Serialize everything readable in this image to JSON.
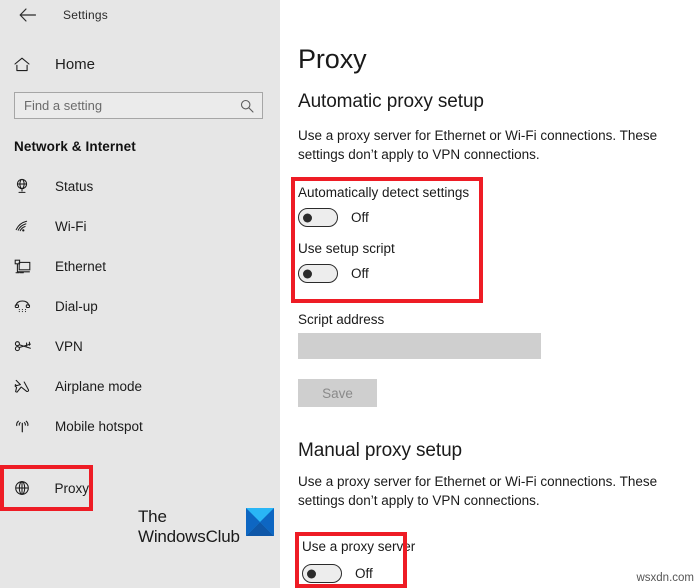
{
  "window": {
    "back_icon": "back-arrow-icon",
    "title": "Settings"
  },
  "sidebar": {
    "home": {
      "label": "Home",
      "icon": "home-icon"
    },
    "search": {
      "placeholder": "Find a setting",
      "value": "",
      "icon": "search-icon"
    },
    "section_title": "Network & Internet",
    "items": [
      {
        "label": "Status",
        "icon": "status-globe-icon",
        "selected": false
      },
      {
        "label": "Wi-Fi",
        "icon": "wifi-icon",
        "selected": false
      },
      {
        "label": "Ethernet",
        "icon": "ethernet-icon",
        "selected": false
      },
      {
        "label": "Dial-up",
        "icon": "dialup-phone-icon",
        "selected": false
      },
      {
        "label": "VPN",
        "icon": "vpn-key-icon",
        "selected": false
      },
      {
        "label": "Airplane mode",
        "icon": "airplane-icon",
        "selected": false
      },
      {
        "label": "Mobile hotspot",
        "icon": "hotspot-icon",
        "selected": false
      },
      {
        "label": "Proxy",
        "icon": "proxy-globe-icon",
        "selected": true
      }
    ],
    "watermark": {
      "line1": "The",
      "line2": "WindowsClub"
    }
  },
  "main": {
    "page_title": "Proxy",
    "automatic": {
      "heading": "Automatic proxy setup",
      "description": "Use a proxy server for Ethernet or Wi-Fi connections. These settings don’t apply to VPN connections.",
      "auto_detect": {
        "label": "Automatically detect settings",
        "state": "Off"
      },
      "setup_script": {
        "label": "Use setup script",
        "state": "Off"
      },
      "script_address": {
        "label": "Script address",
        "value": "",
        "placeholder": ""
      },
      "save_button": "Save"
    },
    "manual": {
      "heading": "Manual proxy setup",
      "description": "Use a proxy server for Ethernet or Wi-Fi connections. These settings don’t apply to VPN connections.",
      "use_proxy": {
        "label": "Use a proxy server",
        "state": "Off"
      }
    }
  },
  "overlay": {
    "highlight_color": "#ee1c25",
    "source_watermark": "wsxdn.com"
  }
}
